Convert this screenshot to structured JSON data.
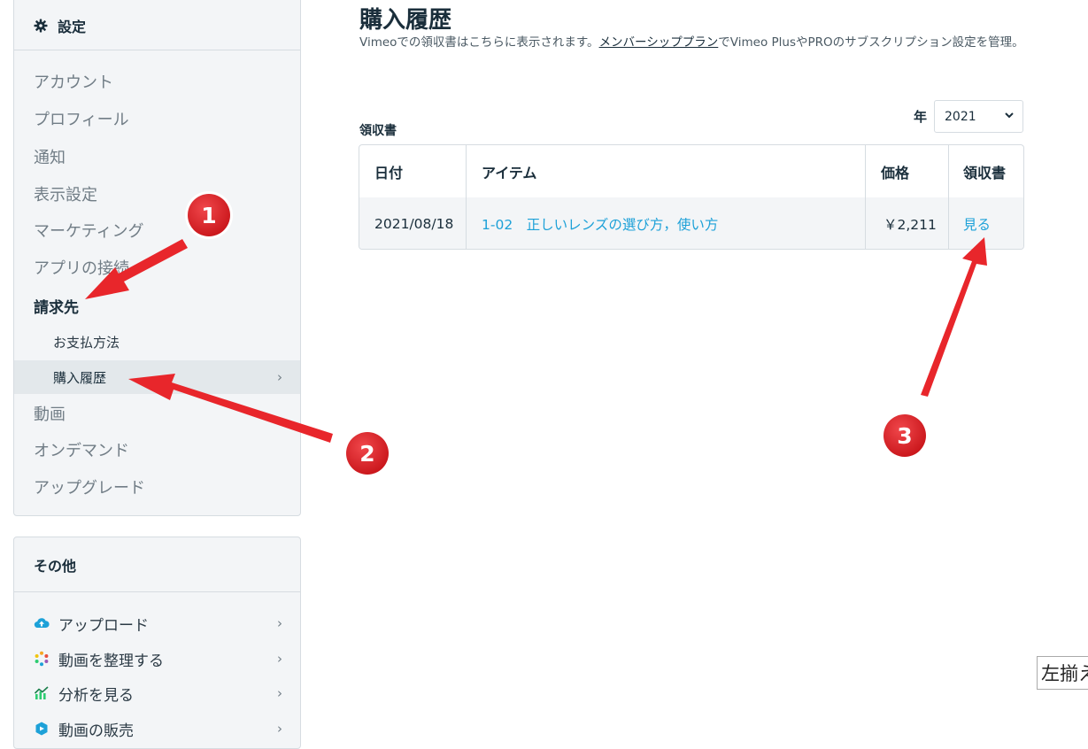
{
  "sidebar": {
    "title": "設定",
    "items": [
      {
        "label": "アカウント"
      },
      {
        "label": "プロフィール"
      },
      {
        "label": "通知"
      },
      {
        "label": "表示設定"
      },
      {
        "label": "マーケティング"
      },
      {
        "label": "アプリの接続"
      },
      {
        "label": "請求先"
      },
      {
        "label": "お支払方法"
      },
      {
        "label": "購入履歴",
        "chevron": "›"
      },
      {
        "label": "動画"
      },
      {
        "label": "オンデマンド"
      },
      {
        "label": "アップグレード"
      }
    ]
  },
  "other_panel": {
    "title": "その他",
    "items": [
      {
        "label": "アップロード",
        "icon": "cloud-upload-icon",
        "chevron": "›"
      },
      {
        "label": "動画を整理する",
        "icon": "organize-icon",
        "chevron": "›"
      },
      {
        "label": "分析を見る",
        "icon": "analytics-icon",
        "chevron": "›"
      },
      {
        "label": "動画の販売",
        "icon": "sell-icon",
        "chevron": "›"
      }
    ]
  },
  "main": {
    "title": "購入履歴",
    "description_before": "Vimeoでの領収書はこちらに表示されます。",
    "description_link": "メンバーシッププラン",
    "description_after": "でVimeo PlusやPROのサブスクリプション設定を管理。",
    "receipts_label": "領収書",
    "year_label": "年",
    "year_value": "2021",
    "table": {
      "headers": {
        "date": "日付",
        "item": "アイテム",
        "price": "価格",
        "receipt": "領収書"
      },
      "rows": [
        {
          "date": "2021/08/18",
          "item": "1-02　正しいレンズの選び方，使い方",
          "price": "￥2,211",
          "receipt": "見る"
        }
      ]
    }
  },
  "tooltip_fragment": "左揃え",
  "annotations": {
    "badge_1": "1",
    "badge_2": "2",
    "badge_3": "3",
    "color": "#e8262b"
  }
}
